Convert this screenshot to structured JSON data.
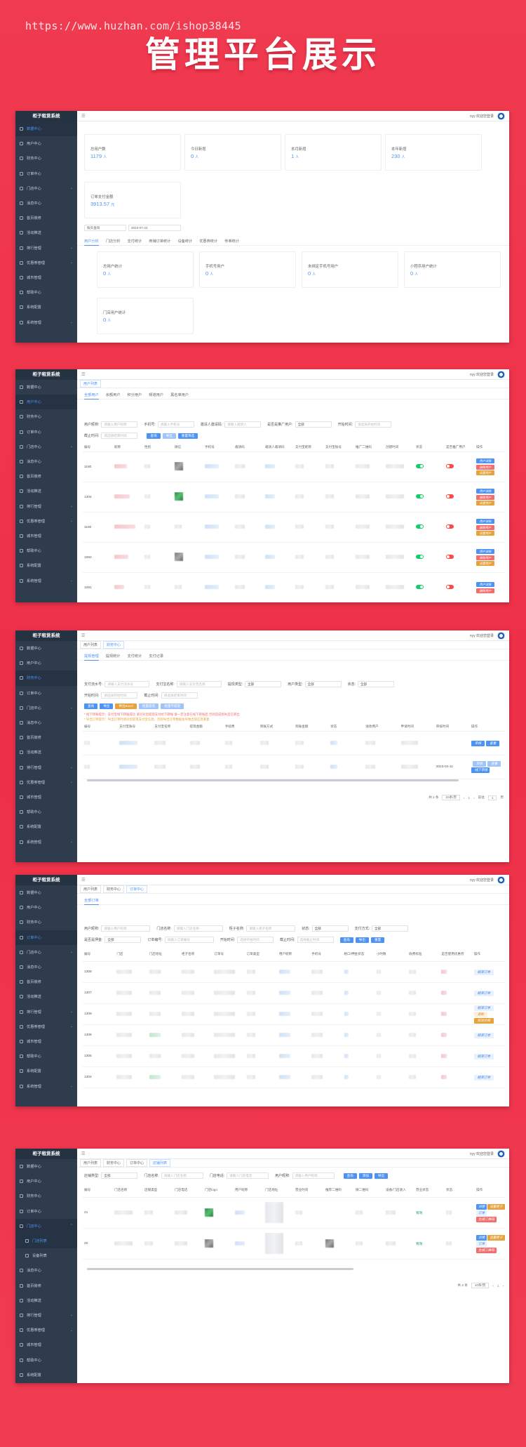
{
  "watermark": "https://www.huzhan.com/ishop38445",
  "hero": "管理平台展示",
  "common": {
    "brand": "柜子租赁系统",
    "user": "nyy 欢迎您登录"
  },
  "s1": {
    "menu": [
      "数据中心",
      "用户中心",
      "财务中心",
      "订单中心",
      "门店中心",
      "消息中心",
      "首页装修",
      "活动推送",
      "排行管理",
      "优惠券管理",
      "城市管理",
      "帮助中心",
      "系统配置",
      "系统管理"
    ],
    "cards": [
      {
        "label": "总用户数",
        "value": "1179",
        "unit": "人"
      },
      {
        "label": "今日新增",
        "value": "0",
        "unit": "人"
      },
      {
        "label": "本月新增",
        "value": "1",
        "unit": "人"
      },
      {
        "label": "本年新增",
        "value": "230",
        "unit": "人"
      },
      {
        "label": "订单支付金额",
        "value": "3913.57",
        "unit": "元"
      }
    ],
    "filter": {
      "select": "按天查询",
      "date": "2023-07-24"
    },
    "tabs": [
      "用户分析",
      "门店分析",
      "支付统计",
      "商铺订单统计",
      "设备统计",
      "优惠券统计",
      "传单统计"
    ],
    "cards2": [
      {
        "label": "总用户统计",
        "value": "0",
        "unit": "人"
      },
      {
        "label": "手机号用户",
        "value": "0",
        "unit": "人"
      },
      {
        "label": "未绑定手机号用户",
        "value": "0",
        "unit": "人"
      },
      {
        "label": "小程序用户统计",
        "value": "0",
        "unit": "人"
      },
      {
        "label": "门店用户统计",
        "value": "0",
        "unit": "人"
      }
    ]
  },
  "s2": {
    "tag": "用户列表",
    "tabs": [
      "全部用户",
      "余额用户",
      "积分用户",
      "频道用户",
      "黑名单用户"
    ],
    "filters": {
      "nick": "用户昵称:",
      "nick_ph": "请输入用户昵称",
      "phone": "手机号:",
      "phone_ph": "请输入手机号",
      "inviter": "邀请人邀请码:",
      "inviter_ph": "请输入邀请人",
      "promo": "是否是推广用户:",
      "promo_val": "全部",
      "start": "开始时间:",
      "start_ph": "请选择开始时间",
      "end": "截止时间:",
      "end_ph": "请选择结束时间"
    },
    "buttons": [
      "查询",
      "导出",
      "重置筛选"
    ],
    "cols": [
      "编号",
      "昵称",
      "性别",
      "微信",
      "手机号",
      "邀请码",
      "邀请人邀请码",
      "支付宝昵称",
      "支付宝账号",
      "推广二维码",
      "创建时间",
      "状态",
      "是否推广用户",
      "操作"
    ],
    "ids": [
      "1180",
      "1304",
      "1180",
      "1092",
      "1091"
    ],
    "actions": [
      "用户详情",
      "删除用户",
      "设置用户"
    ]
  },
  "s3": {
    "tags": [
      "用户列表",
      "财务中心"
    ],
    "tabs": [
      "提现管理",
      "提现统计",
      "支付统计",
      "支付记录"
    ],
    "filters": {
      "pay": "支付流水号:",
      "pay_ph": "请输入支付流水号",
      "payname": "支付宝名称:",
      "payname_ph": "请输入支付宝名称",
      "type": "提现类型:",
      "type_val": "全部",
      "utype": "用户类型:",
      "utype_val": "全部",
      "state": "状态:",
      "state_val": "全部",
      "start": "开始时间:",
      "start_ph": "请选择开始时间",
      "end": "截止时间:",
      "end_ph": "请选择结束时间"
    },
    "buttons": [
      "查询",
      "导出",
      "导出Excel",
      "批量提现",
      "批量不提现"
    ],
    "note1": "* 线下转账提示：支付宝线下转账成功 请对对您提现支付给下转账 请一定注意在线下转账后 否则造成损失后已转出",
    "note2": "* 导出订单提示：导出订单时请对您提现支付宝信息，否则导出订单数据会导致出现信息重复",
    "cols": [
      "编号",
      "支付宝账号",
      "支付宝名称",
      "提现金额",
      "手续费",
      "到账方式",
      "到账金额",
      "状态",
      "收款用户",
      "申请时间",
      "审核时间",
      "操作"
    ],
    "date": "2023-04-11",
    "acts": [
      "审核",
      "查看",
      "线下审核"
    ],
    "pager": {
      "total": "共 2 条",
      "size": "10条/页",
      "page": "1",
      "goto": "前往",
      "pages": "页"
    }
  },
  "s4": {
    "tags": [
      "用户列表",
      "财务中心",
      "订单中心"
    ],
    "tabs": [
      "全部订单"
    ],
    "filters": {
      "user": "用户昵称:",
      "user_ph": "请输入用户昵称",
      "store": "门店名称:",
      "store_ph": "请输入门店名称",
      "cab": "柜子名称:",
      "cab_ph": "请输入柜子名称",
      "state": "状态:",
      "state_val": "全部",
      "pay": "支付方式:",
      "pay_val": "全部",
      "deposit": "是否是押金:",
      "deposit_val": "全部",
      "order": "订单编号:",
      "order_ph": "请输入订单编号",
      "start": "开始时间:",
      "start_ph": "选择开始时间",
      "end": "截止时间:",
      "end_ph": "选择截止时间"
    },
    "buttons": [
      "查询",
      "导出",
      "重置"
    ],
    "cols": [
      "编号",
      "门店",
      "门店地址",
      "柜子名称",
      "订单号",
      "订单类型",
      "用户昵称",
      "手机号",
      "格口/押金状态",
      "小时数",
      "收费标准",
      "是否使用优惠券",
      "操作"
    ],
    "ids": [
      "1308",
      "1307",
      "1309",
      "1306",
      "1305",
      "1304"
    ],
    "acts": [
      "结束订单",
      "退款",
      "修改价格"
    ]
  },
  "s5": {
    "tags": [
      "用户列表",
      "财务中心",
      "订单中心",
      "店铺列表"
    ],
    "menu_sub": [
      "门店列表",
      "设备列表"
    ],
    "filters": {
      "addr": "店铺类型:",
      "addr_val": "全部",
      "name": "门店名称:",
      "name_ph": "请输入门店名称",
      "phone": "门店电话:",
      "phone_ph": "请输入门店电话",
      "user": "用户昵称:",
      "user_ph": "请输入用户昵称"
    },
    "buttons": [
      "查询",
      "添加",
      "导出"
    ],
    "cols": [
      "编号",
      "门店名称",
      "店铺类型",
      "门店电话",
      "门店logo",
      "用户昵称",
      "门店地址",
      "营业时间",
      "推荐二维码",
      "微二维码",
      "设备/门店收入",
      "营业状态",
      "状态",
      "操作"
    ],
    "ids": [
      "21",
      "20"
    ],
    "acts": [
      "详情",
      "设置柜子",
      "订单",
      "生成二维码"
    ],
    "states": [
      "有效",
      "有效"
    ],
    "pager": {
      "total": "共 2 条",
      "size": "10条/页",
      "page": "1"
    }
  }
}
